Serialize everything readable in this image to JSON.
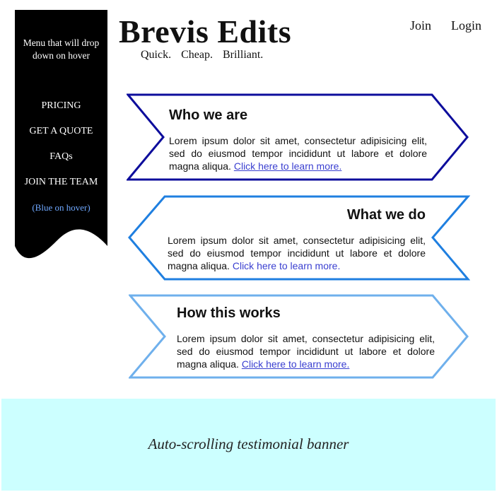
{
  "sidebar": {
    "note": "Menu that will drop down on hover",
    "items": [
      {
        "label": "PRICING"
      },
      {
        "label": "GET A QUOTE"
      },
      {
        "label": "FAQs"
      },
      {
        "label": "JOIN THE TEAM"
      }
    ],
    "hover_note": "(Blue on hover)"
  },
  "header": {
    "title": "Brevis Edits",
    "tagline": "Quick. Cheap. Brilliant.",
    "nav": {
      "join": "Join",
      "login": "Login"
    }
  },
  "sections": [
    {
      "title": "Who we are",
      "body": "Lorem ipsum dolor sit amet, consectetur adipisicing elit, sed do eiusmod tempor incididunt ut labore et dolore magna aliqua.",
      "link": "Click here to learn more.",
      "color": "#0d0d9c"
    },
    {
      "title": "What we do",
      "body": "Lorem ipsum dolor sit amet, consectetur adipisicing elit, sed do eiusmod tempor incididunt ut labore et dolore magna aliqua.",
      "link": "Click here to learn more.",
      "color": "#1f7fe0"
    },
    {
      "title": "How this works",
      "body": "Lorem ipsum dolor sit amet, consectetur adipisicing elit, sed do eiusmod tempor incididunt ut labore et dolore magna aliqua.",
      "link": "Click here to learn more.",
      "color": "#6fb0ec"
    }
  ],
  "banner": {
    "text": "Auto-scrolling testimonial banner",
    "background": "#ccffff"
  },
  "colors": {
    "sidebar_bg": "#000000",
    "link": "#3a3fd0",
    "hover_blue": "#6fa8ff"
  }
}
